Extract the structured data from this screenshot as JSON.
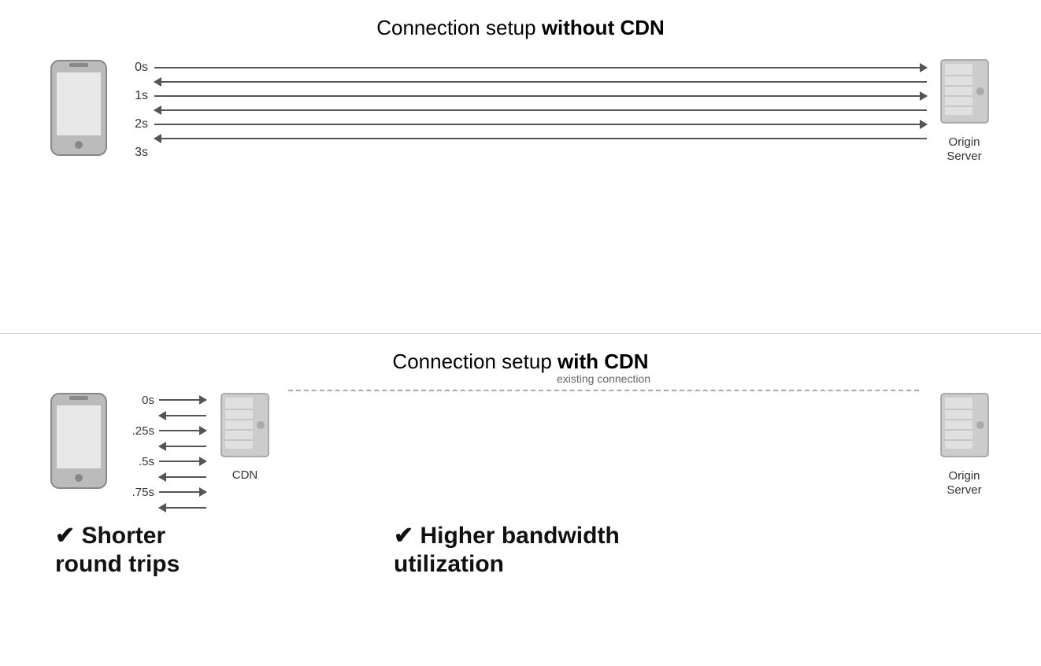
{
  "top_section": {
    "title_normal": "Connection setup ",
    "title_bold": "without CDN",
    "times": [
      "0s",
      "1s",
      "2s",
      "3s"
    ],
    "server_label": "Origin\nServer"
  },
  "bottom_section": {
    "title_normal": "Connection setup ",
    "title_bold": "with CDN",
    "times": [
      "0s",
      ".25s",
      ".5s",
      ".75s"
    ],
    "cdn_label": "CDN",
    "existing_connection_label": "existing connection",
    "server_label": "Origin\nServer",
    "benefit_left": "✔ Shorter\nround trips",
    "benefit_right": "✔ Higher bandwidth\nutilization"
  }
}
